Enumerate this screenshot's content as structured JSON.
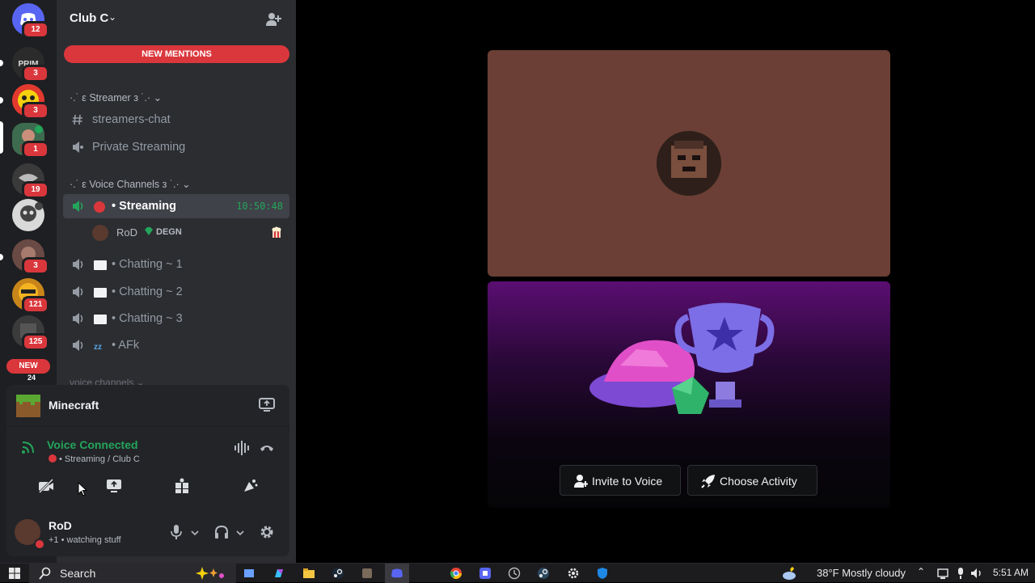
{
  "rail": {
    "servers": [
      {
        "id": "direct-messages",
        "badge": "12"
      },
      {
        "id": "server-prim",
        "badge": "3"
      },
      {
        "id": "server-2",
        "badge": "3"
      },
      {
        "id": "server-club-c",
        "badge": "1"
      },
      {
        "id": "server-4",
        "badge": "19"
      },
      {
        "id": "server-5",
        "badge": ""
      },
      {
        "id": "server-6",
        "badge": "3"
      },
      {
        "id": "server-7",
        "badge": "121"
      },
      {
        "id": "server-8",
        "badge": "125"
      }
    ],
    "new_label": "NEW",
    "new_count": "24"
  },
  "server": {
    "name": "Club C"
  },
  "mentions_label": "NEW MENTIONS",
  "categories": {
    "streamer": "·.˙ ε Streamer з ˙.· ⌄",
    "voice": "·.˙ ε Voice Channels з ˙.· ⌄",
    "voice_lower": "voice channels ⌄"
  },
  "channels": {
    "streamers_chat": "streamers-chat",
    "private_streaming": "Private Streaming",
    "streaming": "• Streaming",
    "streaming_timer": "10:50:48",
    "chatting1": "• Chatting ~ 1",
    "chatting2": "• Chatting ~ 2",
    "chatting3": "• Chatting ~ 3",
    "afk": "• AFk"
  },
  "member": {
    "name": "RoD",
    "tag": "DEGN"
  },
  "activity": {
    "title": "Minecraft"
  },
  "voice": {
    "status": "Voice Connected",
    "location": "• Streaming / Club C"
  },
  "user": {
    "name": "RoD",
    "status": "+1 • watching stuff"
  },
  "stage": {
    "invite_label": "Invite to Voice",
    "activity_label": "Choose Activity"
  },
  "taskbar": {
    "search_label": "Search",
    "weather": "38°F  Mostly cloudy",
    "time": "5:51 AM"
  },
  "colors": {
    "accent_red": "#da373c",
    "voice_green": "#23a55a",
    "tile_bg": "#6b3f35"
  }
}
